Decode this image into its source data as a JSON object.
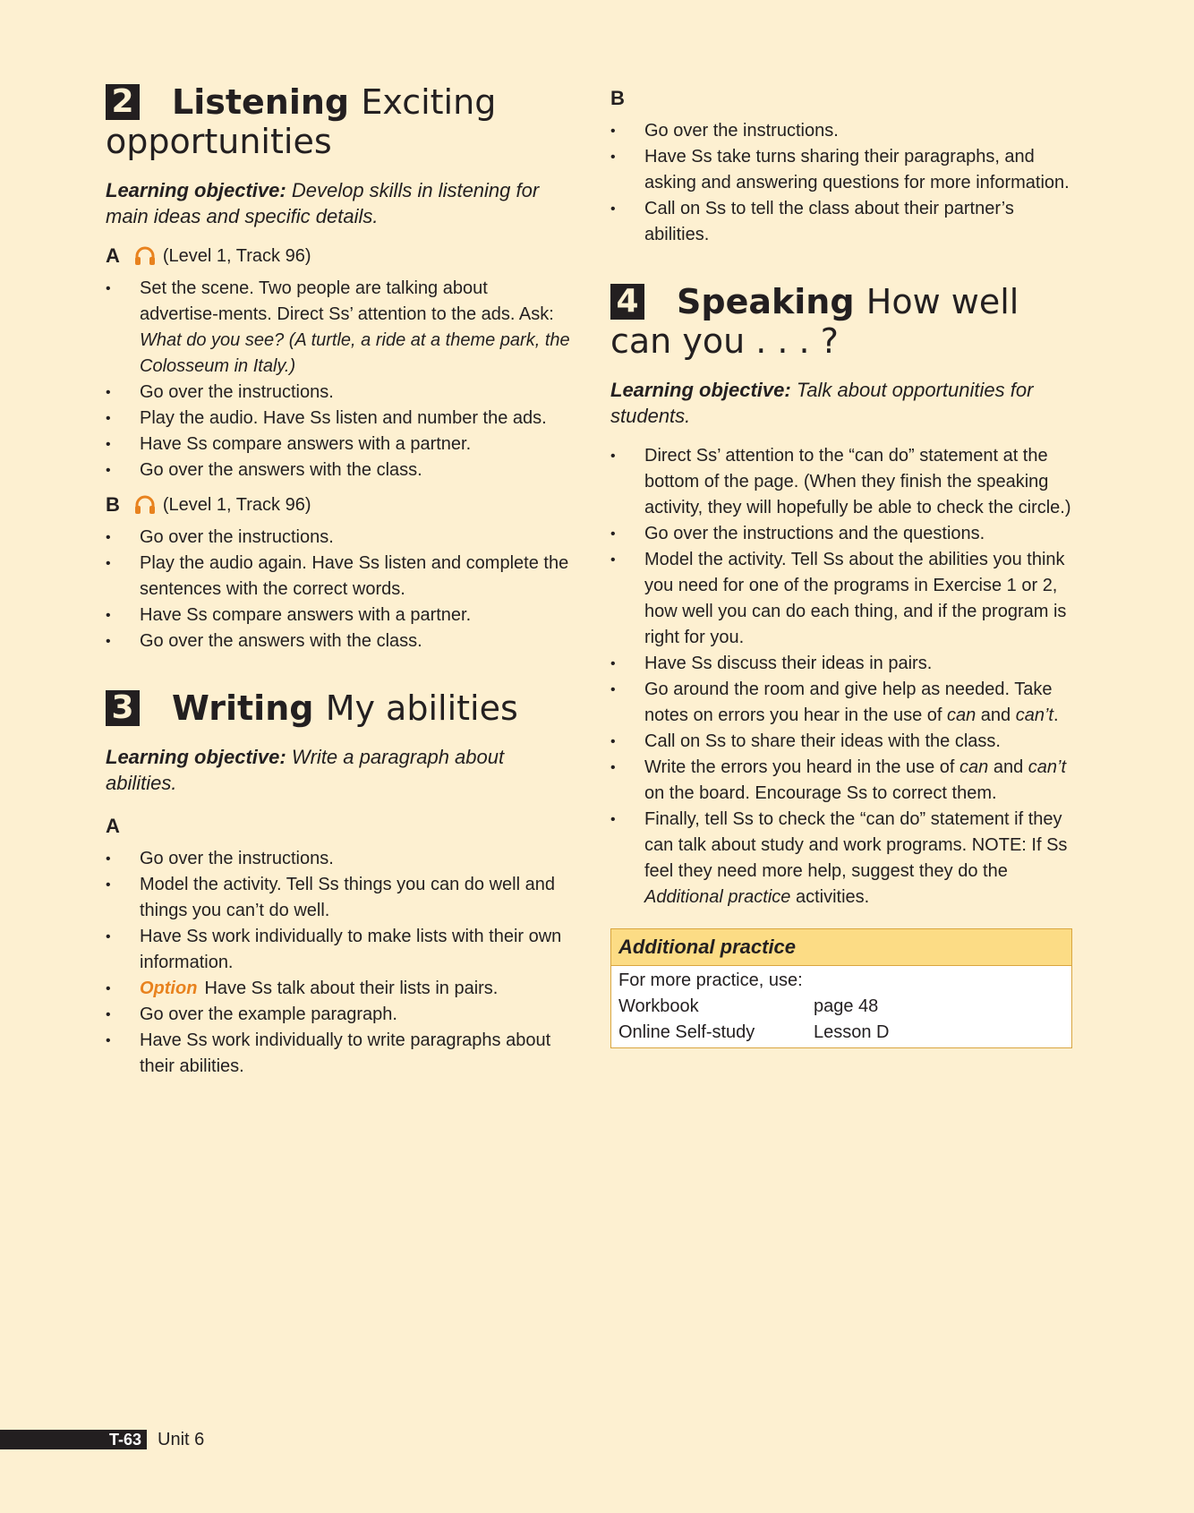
{
  "left": {
    "s2": {
      "num": "2",
      "title_bold": "Listening",
      "title_light": "Exciting opportunities",
      "objective_label": "Learning objective:",
      "objective_text": "Develop skills in listening for main ideas and specific details.",
      "a_letter": "A",
      "a_audio": "(Level 1, Track 96)",
      "a_bullets": {
        "b1_text": "Set the scene. Two people are talking about advertise-ments. Direct Ss’ attention to the ads. Ask: ",
        "b1_italic": "What do you see? (A turtle, a ride at a theme park, the Colosseum in Italy.)",
        "b2": "Go over the instructions.",
        "b3": "Play the audio. Have Ss listen and number the ads.",
        "b4": "Have Ss compare answers with a partner.",
        "b5": "Go over the answers with the class."
      },
      "b_letter": "B",
      "b_audio": "(Level 1, Track 96)",
      "b_bullets": [
        "Go over the instructions.",
        "Play the audio again. Have Ss listen and complete the sentences with the correct words.",
        "Have Ss compare answers with a partner.",
        "Go over the answers with the class."
      ]
    },
    "s3": {
      "num": "3",
      "title_bold": "Writing",
      "title_light": "My abilities",
      "objective_label": "Learning objective:",
      "objective_text": "Write a paragraph about abilities.",
      "a_letter": "A",
      "bullets": {
        "b1": "Go over the instructions.",
        "b2": "Model the activity. Tell Ss things you can do well and things you can’t do well.",
        "b3": "Have Ss work individually to make lists with their own information.",
        "b4_tag": "Option",
        "b4_text": "Have Ss talk about their lists in pairs.",
        "b5": "Go over the example paragraph.",
        "b6": "Have Ss work individually to write paragraphs about their abilities."
      }
    }
  },
  "right": {
    "s3b": {
      "letter": "B",
      "bullets": [
        "Go over the instructions.",
        "Have Ss take turns sharing their paragraphs, and asking and answering questions for more information.",
        "Call on Ss to tell the class about their partner’s abilities."
      ]
    },
    "s4": {
      "num": "4",
      "title_bold": "Speaking",
      "title_light": "How well can you . . . ?",
      "objective_label": "Learning objective:",
      "objective_text": "Talk about opportunities for students.",
      "bullets": {
        "b1": "Direct Ss’ attention to the “can do” statement at the bottom of the page. (When they finish the speaking activity, they will hopefully be able to check the circle.)",
        "b2": "Go over the instructions and the questions.",
        "b3": "Model the activity. Tell Ss about the abilities you think you need for one of the programs in Exercise 1 or 2, how well you can do each thing, and if the program is right for you.",
        "b4": "Have Ss discuss their ideas in pairs.",
        "b5_a": "Go around the room and give help as needed. Take notes on errors you hear in the use of ",
        "b5_can": "can",
        "b5_and": " and ",
        "b5_cant": "can’t",
        "b5_end": ".",
        "b6": "Call on Ss to share their ideas with the class.",
        "b7_a": "Write the errors you heard in the use of ",
        "b7_can": "can",
        "b7_and": " and ",
        "b7_cant": "can’t",
        "b7_end": " on the board. Encourage Ss to correct them.",
        "b8_a": "Finally, tell Ss to check the “can do” statement if they can talk about study and work programs. NOTE: If Ss feel they need more help, suggest they do the ",
        "b8_it": "Additional practice",
        "b8_end": " activities."
      }
    },
    "practice": {
      "title": "Additional practice",
      "intro": "For more practice, use:",
      "rows": [
        {
          "k": "Workbook",
          "v": "page 48"
        },
        {
          "k": "Online Self-study",
          "v": "Lesson D"
        }
      ]
    }
  },
  "footer": {
    "page": "T-63",
    "unit": "Unit 6"
  },
  "colors": {
    "background": "#fdf0d1",
    "accent_orange": "#e8821e",
    "practice_header": "#fcdc85"
  },
  "icons": [
    "headphones-icon"
  ]
}
